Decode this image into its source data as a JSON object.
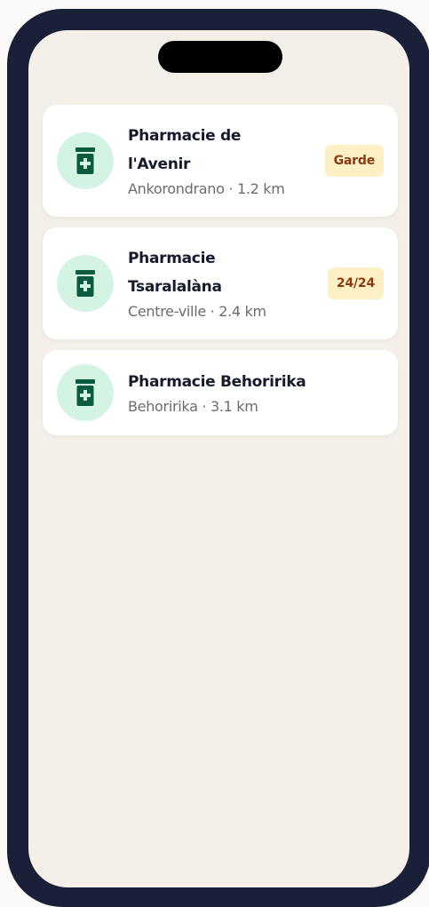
{
  "pharmacies": [
    {
      "name_line1": "Pharmacie de",
      "name_line2": "l'Avenir",
      "meta": "Ankorondrano · 1.2 km",
      "badge": "Garde"
    },
    {
      "name_line1": "Pharmacie",
      "name_line2": "Tsaralalàna",
      "meta": "Centre-ville · 2.4 km",
      "badge": "24/24"
    },
    {
      "name_line1": "Pharmacie Behoririka",
      "meta": "Behoririka · 3.1 km"
    }
  ],
  "colors": {
    "icon_background": "#d3f4e3",
    "icon_foreground": "#0b5c3f",
    "badge_background": "#fdf0c4",
    "badge_text": "#8a3a10",
    "screen_background": "#f4efe9",
    "frame": "#1b2039"
  },
  "icons": {
    "pharmacy": "medicine-jar-icon"
  }
}
